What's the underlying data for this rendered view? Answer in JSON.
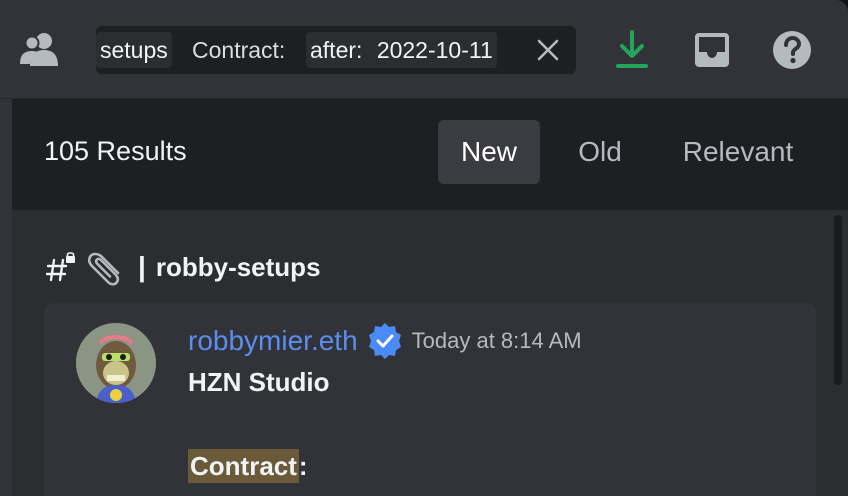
{
  "toolbar": {
    "search_tokens": {
      "channel_filter": "setups",
      "contract_label": "Contract:",
      "after_label": "after:",
      "after_value": "2022-10-11"
    },
    "icons": [
      "members-icon",
      "close-icon",
      "download-icon",
      "inbox-icon",
      "help-icon"
    ],
    "download_color": "#23a55a"
  },
  "results": {
    "count_label": "105 Results",
    "sort_tabs": [
      {
        "label": "New",
        "active": true
      },
      {
        "label": "Old",
        "active": false
      },
      {
        "label": "Relevant",
        "active": false
      }
    ]
  },
  "channel": {
    "hash": "#",
    "emoji": "📎",
    "separator": "|",
    "name": "robby-setups"
  },
  "message": {
    "author": "robbymier.eth",
    "timestamp": "Today at 8:14 AM",
    "line1": "HZN Studio",
    "line2_highlight": "Contract",
    "line2_rest": ":",
    "author_color": "#5b8dee",
    "highlight_color": "#6b5a3a"
  }
}
